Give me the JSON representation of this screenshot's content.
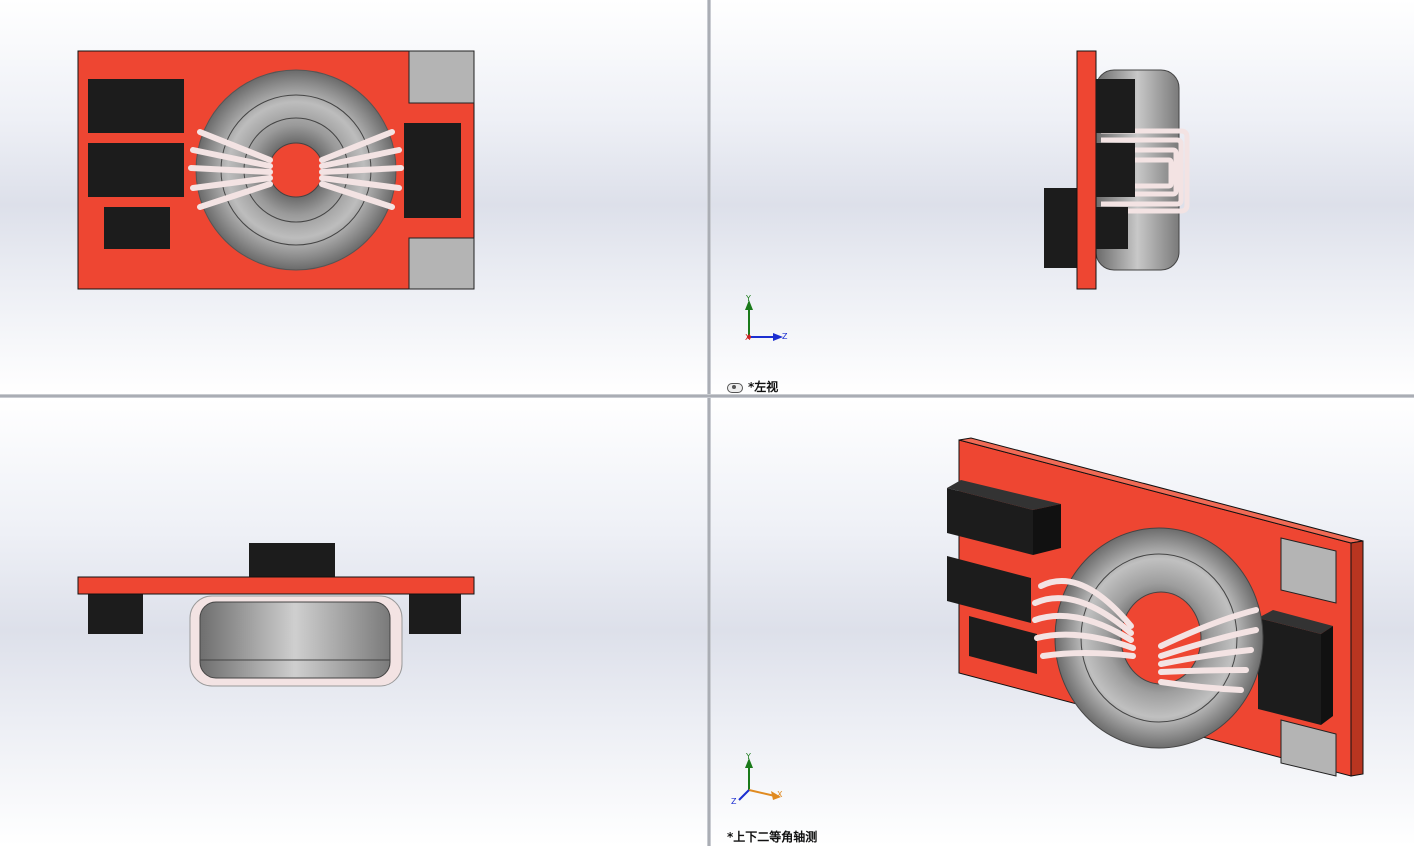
{
  "views": {
    "front": {
      "label": ""
    },
    "left": {
      "label": "*左视"
    },
    "top": {
      "label": ""
    },
    "iso": {
      "label": "*上下二等角轴测"
    }
  },
  "triad": {
    "left": {
      "y": "Y",
      "x": "X",
      "z": "Z"
    },
    "iso": {
      "y": "Y",
      "x": "X",
      "z": "Z"
    }
  },
  "colors": {
    "pcb_red": "#ee4632",
    "component_black": "#1c1c1c",
    "pad_gray": "#b4b4b4",
    "core_gray": "#8c8c8c",
    "winding_white": "#f3e3e3",
    "axis_y": "#1a7a1a",
    "axis_z": "#1c2fd1",
    "axis_x": "#cc2222",
    "axis_iso_x": "#e08a20"
  },
  "icons": [
    "eye-icon",
    "coordinate-triad-icon"
  ]
}
